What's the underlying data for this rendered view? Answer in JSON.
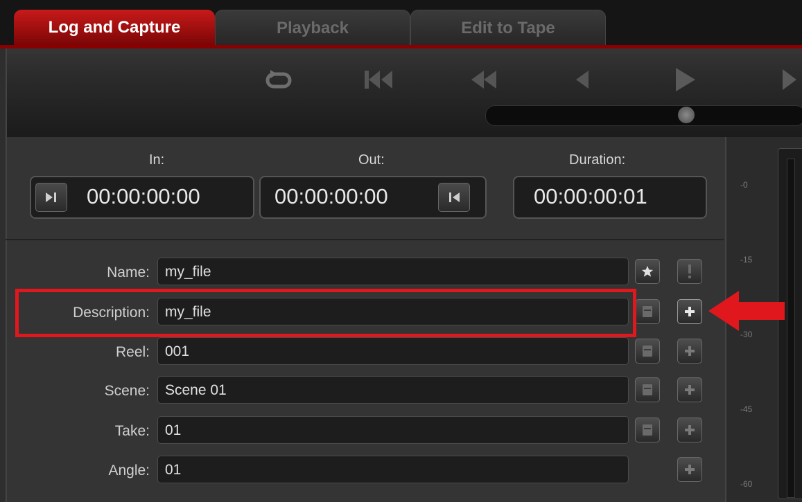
{
  "tabs": [
    {
      "label": "Log and Capture",
      "active": true
    },
    {
      "label": "Playback",
      "active": false
    },
    {
      "label": "Edit to Tape",
      "active": false
    }
  ],
  "transport": {
    "buttons": [
      "loop-icon",
      "go-to-start-icon",
      "rewind-icon",
      "step-back-icon",
      "play-icon",
      "step-forward-icon"
    ]
  },
  "timecode": {
    "in_label": "In:",
    "in_value": "00:00:00:00",
    "out_label": "Out:",
    "out_value": "00:00:00:00",
    "duration_label": "Duration:",
    "duration_value": "00:00:00:01"
  },
  "log": {
    "name_label": "Name:",
    "name_value": "my_file",
    "description_label": "Description:",
    "description_value": "my_file",
    "reel_label": "Reel:",
    "reel_value": "001",
    "scene_label": "Scene:",
    "scene_value": "Scene 01",
    "take_label": "Take:",
    "take_value": "01",
    "angle_label": "Angle:",
    "angle_value": "01"
  },
  "meter": {
    "labels": [
      "-0",
      "-15",
      "-30",
      "-45",
      "-60"
    ]
  },
  "colors": {
    "accent": "#c81a1a",
    "annotation": "#e0181e",
    "panel": "#343434"
  }
}
